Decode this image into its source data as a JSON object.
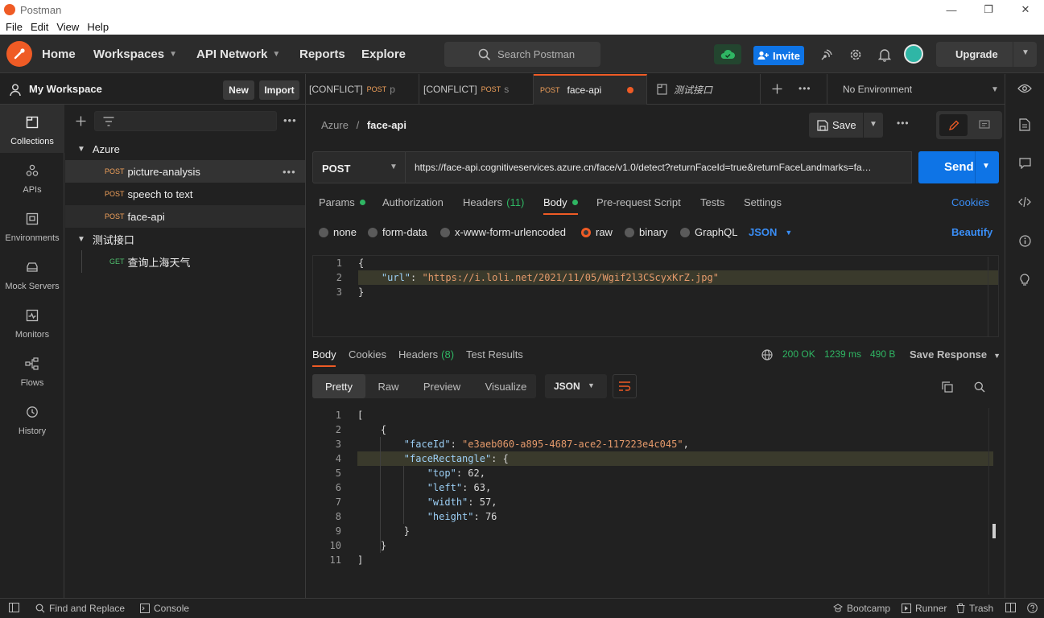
{
  "window": {
    "title": "Postman",
    "minimize": "—",
    "maximize": "❐",
    "close": "✕"
  },
  "menu": [
    "File",
    "Edit",
    "View",
    "Help"
  ],
  "header": {
    "nav": {
      "home": "Home",
      "workspaces": "Workspaces",
      "api_network": "API Network",
      "reports": "Reports",
      "explore": "Explore"
    },
    "search_placeholder": "Search Postman",
    "invite": "Invite",
    "upgrade": "Upgrade"
  },
  "workspace": {
    "name": "My Workspace",
    "new": "New",
    "import": "Import"
  },
  "rail": [
    {
      "label": "Collections",
      "icon": "collections-icon"
    },
    {
      "label": "APIs",
      "icon": "apis-icon"
    },
    {
      "label": "Environments",
      "icon": "environments-icon"
    },
    {
      "label": "Mock Servers",
      "icon": "mock-servers-icon"
    },
    {
      "label": "Monitors",
      "icon": "monitors-icon"
    },
    {
      "label": "Flows",
      "icon": "flows-icon"
    },
    {
      "label": "History",
      "icon": "history-icon"
    }
  ],
  "tree": {
    "folders": [
      {
        "name": "Azure",
        "items": [
          {
            "method": "POST",
            "name": "picture-analysis"
          },
          {
            "method": "POST",
            "name": "speech to text"
          },
          {
            "method": "POST",
            "name": "face-api"
          }
        ]
      },
      {
        "name": "测试接口",
        "items": [
          {
            "method": "GET",
            "name": "查询上海天气"
          }
        ]
      }
    ]
  },
  "tabs": [
    {
      "prefix": "[CONFLICT]",
      "method": "POST",
      "name": "p"
    },
    {
      "prefix": "[CONFLICT]",
      "method": "POST",
      "name": "s"
    },
    {
      "prefix": "",
      "method": "POST",
      "name": "face-api"
    },
    {
      "prefix": "",
      "method": "",
      "name": "测试接口"
    }
  ],
  "environment": "No Environment",
  "request": {
    "breadcrumb_parent": "Azure",
    "breadcrumb_sep": "/",
    "breadcrumb_current": "face-api",
    "save": "Save",
    "method": "POST",
    "url": "https://face-api.cognitiveservices.azure.cn/face/v1.0/detect?returnFaceId=true&returnFaceLandmarks=fa…",
    "send": "Send",
    "tabs": {
      "params": "Params",
      "authorization": "Authorization",
      "headers": "Headers",
      "headers_count": "(11)",
      "body": "Body",
      "prerequest": "Pre-request Script",
      "tests": "Tests",
      "settings": "Settings",
      "cookies": "Cookies"
    },
    "body_modes": {
      "none": "none",
      "form_data": "form-data",
      "urlencoded": "x-www-form-urlencoded",
      "raw": "raw",
      "binary": "binary",
      "graphql": "GraphQL",
      "json": "JSON",
      "beautify": "Beautify"
    },
    "body_lines": [
      {
        "num": "1",
        "text": "{"
      },
      {
        "num": "2",
        "key": "\"url\"",
        "sep": ": ",
        "val": "\"https://i.loli.net/2021/11/05/Wgif2l3CScyxKrZ.jpg\""
      },
      {
        "num": "3",
        "text": "}"
      }
    ]
  },
  "response": {
    "tabs": {
      "body": "Body",
      "cookies": "Cookies",
      "headers": "Headers",
      "headers_count": "(8)",
      "test_results": "Test Results"
    },
    "status": "200 OK",
    "time": "1239 ms",
    "size": "490 B",
    "save_response": "Save Response",
    "formats": {
      "pretty": "Pretty",
      "raw": "Raw",
      "preview": "Preview",
      "visualize": "Visualize"
    },
    "lang": "JSON",
    "lines": [
      {
        "num": "1",
        "text": "["
      },
      {
        "num": "2",
        "text": "{"
      },
      {
        "num": "3",
        "key": "\"faceId\"",
        "sep": ": ",
        "val": "\"e3aeb060-a895-4687-ace2-117223e4c045\"",
        "tail": ","
      },
      {
        "num": "4",
        "key": "\"faceRectangle\"",
        "sep": ": ",
        "open": "{"
      },
      {
        "num": "5",
        "key": "\"top\"",
        "sep": ": ",
        "num_val": "62",
        "tail": ","
      },
      {
        "num": "6",
        "key": "\"left\"",
        "sep": ": ",
        "num_val": "63",
        "tail": ","
      },
      {
        "num": "7",
        "key": "\"width\"",
        "sep": ": ",
        "num_val": "57",
        "tail": ","
      },
      {
        "num": "8",
        "key": "\"height\"",
        "sep": ": ",
        "num_val": "76"
      },
      {
        "num": "9",
        "text": "}"
      },
      {
        "num": "10",
        "text": "}"
      },
      {
        "num": "11",
        "text": "]"
      }
    ]
  },
  "statusbar": {
    "find_replace": "Find and Replace",
    "console": "Console",
    "bootcamp": "Bootcamp",
    "runner": "Runner",
    "trash": "Trash"
  },
  "colors": {
    "accent": "#ef5b25",
    "primary_button": "#0e74e6",
    "success": "#2fb663"
  }
}
